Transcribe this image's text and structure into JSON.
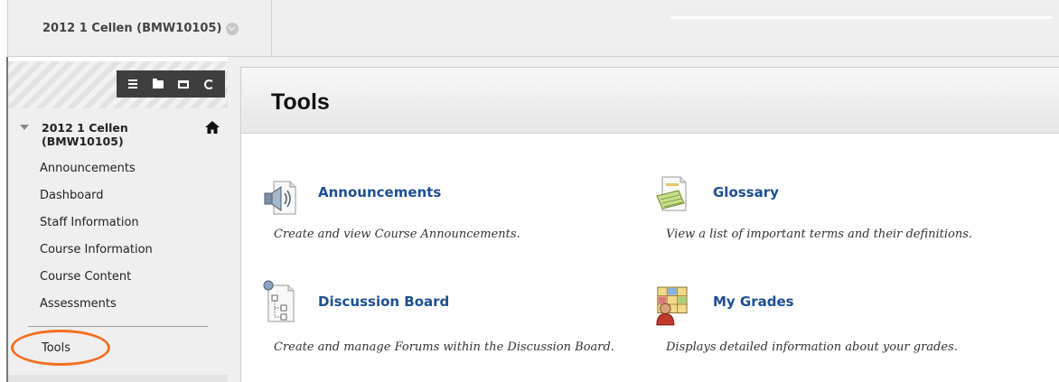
{
  "course_menu": {
    "title": "2012 1 Cellen (BMW10105)"
  },
  "sidebar": {
    "course_title": "2012 1 Cellen (BMW10105)",
    "items": [
      {
        "label": "Announcements"
      },
      {
        "label": "Dashboard"
      },
      {
        "label": "Staff Information"
      },
      {
        "label": "Course Information"
      },
      {
        "label": "Course Content"
      },
      {
        "label": "Assessments"
      }
    ],
    "tools_label": "Tools"
  },
  "page": {
    "title": "Tools"
  },
  "tools": [
    {
      "name": "Announcements",
      "description": "Create and view Course Announcements.",
      "icon": "speaker-document-icon"
    },
    {
      "name": "Glossary",
      "description": "View a list of important terms and their definitions.",
      "icon": "glossary-notepad-icon"
    },
    {
      "name": "Discussion Board",
      "description": "Create and manage Forums within the Discussion Board.",
      "icon": "discussion-tree-icon"
    },
    {
      "name": "My Grades",
      "description": "Displays detailed information about your grades.",
      "icon": "grades-person-icon"
    }
  ],
  "colors": {
    "link": "#1d4f91",
    "highlight_circle": "#f26f21",
    "toolbar": "#3e3e3e"
  }
}
